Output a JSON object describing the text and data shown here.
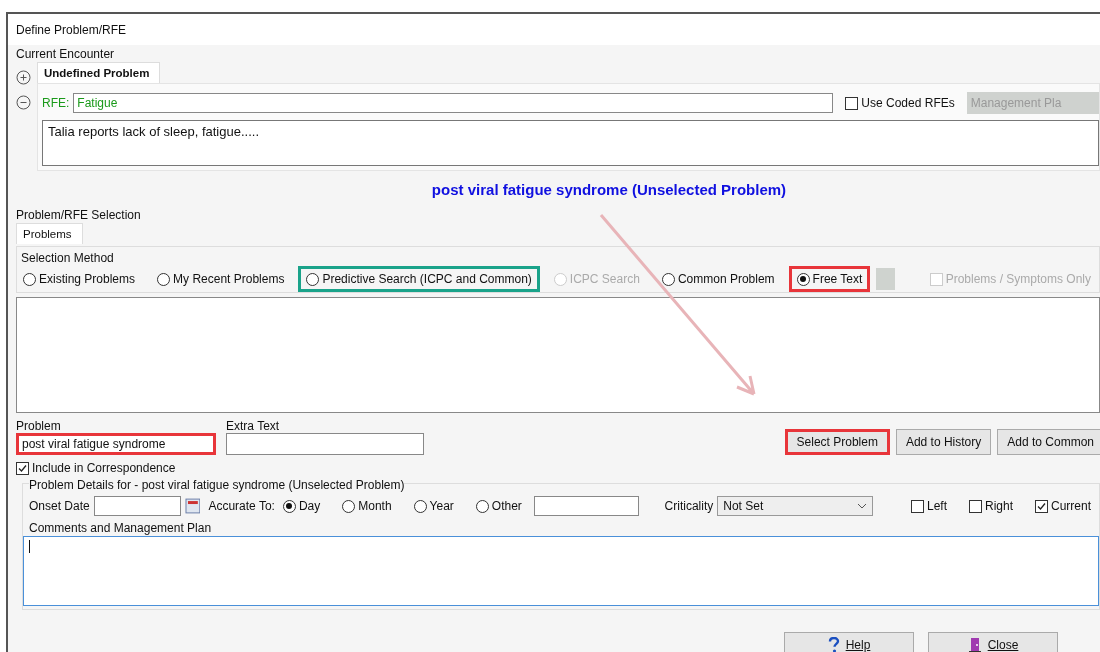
{
  "window": {
    "title": "Define Problem/RFE"
  },
  "current_encounter": {
    "label": "Current Encounter",
    "tab": {
      "label": "Undefined Problem",
      "selected": true
    },
    "rfe_label": "RFE:",
    "rfe_value": "Fatigue",
    "use_coded": {
      "label": "Use Coded RFEs",
      "checked": false
    },
    "management_button": {
      "label": "Management Pla",
      "disabled": true
    },
    "notes": "Talia reports lack of sleep, fatigue....."
  },
  "heading": "post viral fatigue syndrome (Unselected Problem)",
  "selection": {
    "label": "Problem/RFE Selection",
    "tab": {
      "label": "Problems",
      "selected": true
    },
    "method_label": "Selection Method",
    "methods": [
      {
        "label": "Existing Problems",
        "selected": false,
        "disabled": false
      },
      {
        "label": "My Recent Problems",
        "selected": false,
        "disabled": false
      },
      {
        "label": "Predictive Search (ICPC and Common)",
        "selected": false,
        "disabled": false,
        "color": "#1aa38a"
      },
      {
        "label": "ICPC Search",
        "selected": false,
        "disabled": true
      },
      {
        "label": "Common Problem",
        "selected": false,
        "disabled": false
      },
      {
        "label": "Free Text",
        "selected": true,
        "disabled": false,
        "color": "#e8353a"
      }
    ],
    "symptoms_only": {
      "label": "Problems / Symptoms Only",
      "checked": false,
      "disabled": true
    }
  },
  "problem": {
    "label": "Problem",
    "value": "post viral fatigue syndrome",
    "color": "#e8353a"
  },
  "extra_text": {
    "label": "Extra Text"
  },
  "buttons": [
    {
      "label": "Select Problem",
      "color": "#e8353a"
    },
    {
      "label": "Add to History"
    },
    {
      "label": "Add to Common"
    }
  ],
  "include_correspondence": {
    "label": "Include in Correspondence",
    "checked": true
  },
  "details": {
    "label": "Problem Details for - post viral fatigue syndrome (Unselected Problem)",
    "onset_label": "Onset Date",
    "accurate_label": "Accurate To:",
    "accuracy": [
      {
        "label": "Day",
        "selected": true
      },
      {
        "label": "Month",
        "selected": false
      },
      {
        "label": "Year",
        "selected": false
      },
      {
        "label": "Other",
        "selected": false
      }
    ],
    "criticality_label": "Criticality",
    "criticality_value": "Not Set",
    "sides": [
      {
        "label": "Left",
        "checked": false
      },
      {
        "label": "Right",
        "checked": false
      },
      {
        "label": "Current",
        "checked": true
      }
    ]
  },
  "comments": {
    "label": "Comments and Management Plan"
  },
  "footer": [
    {
      "kind": "help",
      "label": "Help"
    },
    {
      "kind": "close",
      "label": "Close"
    }
  ]
}
